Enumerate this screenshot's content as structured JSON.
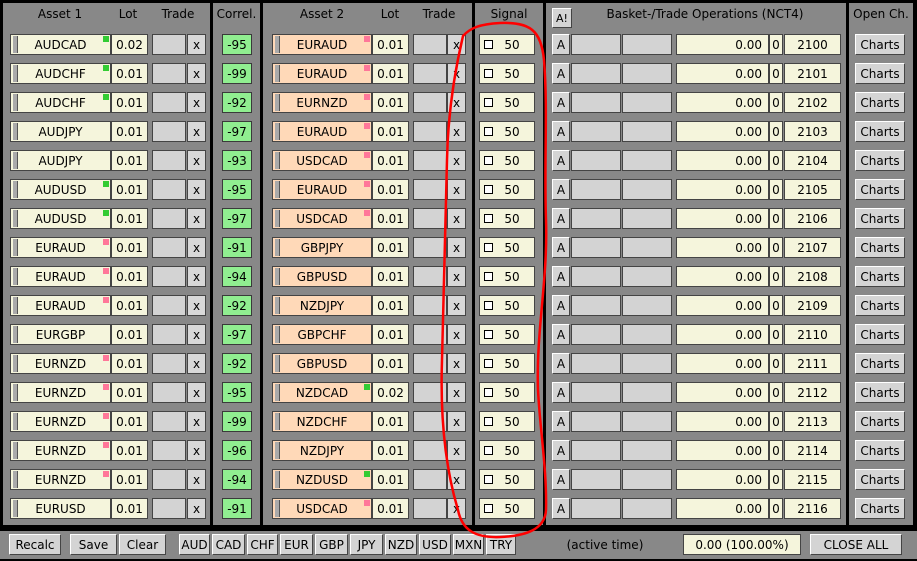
{
  "header": {
    "asset1": "Asset 1",
    "lot1": "Lot",
    "trade1": "Trade",
    "correl": "Correl.",
    "asset2": "Asset 2",
    "lot2": "Lot",
    "trade2": "Trade",
    "signal": "Signal",
    "all_button": "A!",
    "basket": "Basket-/Trade Operations (NCT4)",
    "open_charts": "Open Ch."
  },
  "rows": [
    {
      "asset1": "AUDCAD",
      "flag1": "green",
      "lot1": "0.02",
      "correl": "-95",
      "asset2": "EURAUD",
      "flag2": "pink",
      "lot2": "0.01",
      "signal": "50",
      "a_label": "A",
      "amount": "0.00",
      "count": "0",
      "magic": "2100",
      "charts": "Charts"
    },
    {
      "asset1": "AUDCHF",
      "flag1": "green",
      "lot1": "0.01",
      "correl": "-99",
      "asset2": "EURAUD",
      "flag2": "pink",
      "lot2": "0.01",
      "signal": "50",
      "a_label": "A",
      "amount": "0.00",
      "count": "0",
      "magic": "2101",
      "charts": "Charts"
    },
    {
      "asset1": "AUDCHF",
      "flag1": "green",
      "lot1": "0.01",
      "correl": "-92",
      "asset2": "EURNZD",
      "flag2": "pink",
      "lot2": "0.01",
      "signal": "50",
      "a_label": "A",
      "amount": "0.00",
      "count": "0",
      "magic": "2102",
      "charts": "Charts"
    },
    {
      "asset1": "AUDJPY",
      "flag1": "",
      "lot1": "0.01",
      "correl": "-97",
      "asset2": "EURAUD",
      "flag2": "pink",
      "lot2": "0.01",
      "signal": "50",
      "a_label": "A",
      "amount": "0.00",
      "count": "0",
      "magic": "2103",
      "charts": "Charts"
    },
    {
      "asset1": "AUDJPY",
      "flag1": "",
      "lot1": "0.01",
      "correl": "-93",
      "asset2": "USDCAD",
      "flag2": "pink",
      "lot2": "0.01",
      "signal": "50",
      "a_label": "A",
      "amount": "0.00",
      "count": "0",
      "magic": "2104",
      "charts": "Charts"
    },
    {
      "asset1": "AUDUSD",
      "flag1": "green",
      "lot1": "0.01",
      "correl": "-95",
      "asset2": "EURAUD",
      "flag2": "pink",
      "lot2": "0.01",
      "signal": "50",
      "a_label": "A",
      "amount": "0.00",
      "count": "0",
      "magic": "2105",
      "charts": "Charts"
    },
    {
      "asset1": "AUDUSD",
      "flag1": "green",
      "lot1": "0.01",
      "correl": "-97",
      "asset2": "USDCAD",
      "flag2": "pink",
      "lot2": "0.01",
      "signal": "50",
      "a_label": "A",
      "amount": "0.00",
      "count": "0",
      "magic": "2106",
      "charts": "Charts"
    },
    {
      "asset1": "EURAUD",
      "flag1": "pink",
      "lot1": "0.01",
      "correl": "-91",
      "asset2": "GBPJPY",
      "flag2": "",
      "lot2": "0.01",
      "signal": "50",
      "a_label": "A",
      "amount": "0.00",
      "count": "0",
      "magic": "2107",
      "charts": "Charts"
    },
    {
      "asset1": "EURAUD",
      "flag1": "pink",
      "lot1": "0.01",
      "correl": "-94",
      "asset2": "GBPUSD",
      "flag2": "",
      "lot2": "0.01",
      "signal": "50",
      "a_label": "A",
      "amount": "0.00",
      "count": "0",
      "magic": "2108",
      "charts": "Charts"
    },
    {
      "asset1": "EURAUD",
      "flag1": "pink",
      "lot1": "0.01",
      "correl": "-92",
      "asset2": "NZDJPY",
      "flag2": "",
      "lot2": "0.01",
      "signal": "50",
      "a_label": "A",
      "amount": "0.00",
      "count": "0",
      "magic": "2109",
      "charts": "Charts"
    },
    {
      "asset1": "EURGBP",
      "flag1": "",
      "lot1": "0.01",
      "correl": "-97",
      "asset2": "GBPCHF",
      "flag2": "",
      "lot2": "0.01",
      "signal": "50",
      "a_label": "A",
      "amount": "0.00",
      "count": "0",
      "magic": "2110",
      "charts": "Charts"
    },
    {
      "asset1": "EURNZD",
      "flag1": "pink",
      "lot1": "0.01",
      "correl": "-92",
      "asset2": "GBPUSD",
      "flag2": "",
      "lot2": "0.01",
      "signal": "50",
      "a_label": "A",
      "amount": "0.00",
      "count": "0",
      "magic": "2111",
      "charts": "Charts"
    },
    {
      "asset1": "EURNZD",
      "flag1": "pink",
      "lot1": "0.01",
      "correl": "-95",
      "asset2": "NZDCAD",
      "flag2": "green",
      "lot2": "0.02",
      "signal": "50",
      "a_label": "A",
      "amount": "0.00",
      "count": "0",
      "magic": "2112",
      "charts": "Charts"
    },
    {
      "asset1": "EURNZD",
      "flag1": "pink",
      "lot1": "0.01",
      "correl": "-99",
      "asset2": "NZDCHF",
      "flag2": "",
      "lot2": "0.01",
      "signal": "50",
      "a_label": "A",
      "amount": "0.00",
      "count": "0",
      "magic": "2113",
      "charts": "Charts"
    },
    {
      "asset1": "EURNZD",
      "flag1": "pink",
      "lot1": "0.01",
      "correl": "-96",
      "asset2": "NZDJPY",
      "flag2": "",
      "lot2": "0.01",
      "signal": "50",
      "a_label": "A",
      "amount": "0.00",
      "count": "0",
      "magic": "2114",
      "charts": "Charts"
    },
    {
      "asset1": "EURNZD",
      "flag1": "pink",
      "lot1": "0.01",
      "correl": "-94",
      "asset2": "NZDUSD",
      "flag2": "green",
      "lot2": "0.01",
      "signal": "50",
      "a_label": "A",
      "amount": "0.00",
      "count": "0",
      "magic": "2115",
      "charts": "Charts"
    },
    {
      "asset1": "EURUSD",
      "flag1": "",
      "lot1": "0.01",
      "correl": "-91",
      "asset2": "USDCAD",
      "flag2": "pink",
      "lot2": "0.01",
      "signal": "50",
      "a_label": "A",
      "amount": "0.00",
      "count": "0",
      "magic": "2116",
      "charts": "Charts"
    }
  ],
  "trade_close_label": "x",
  "footer": {
    "recalc": "Recalc",
    "save": "Save",
    "clear": "Clear",
    "currencies": [
      "AUD",
      "CAD",
      "CHF",
      "EUR",
      "GBP",
      "JPY",
      "NZD",
      "USD",
      "MXN",
      "TRY"
    ],
    "active_time": "(active time)",
    "total": "0.00 (100.00%)",
    "close_all": "CLOSE ALL"
  },
  "colors": {
    "panel": "#888888",
    "correl_positive": "#90ee90",
    "asset2_bg": "#ffd9b8",
    "flag_green": "#33cc33",
    "flag_pink": "#ff7799",
    "annotation": "#ff0000"
  }
}
